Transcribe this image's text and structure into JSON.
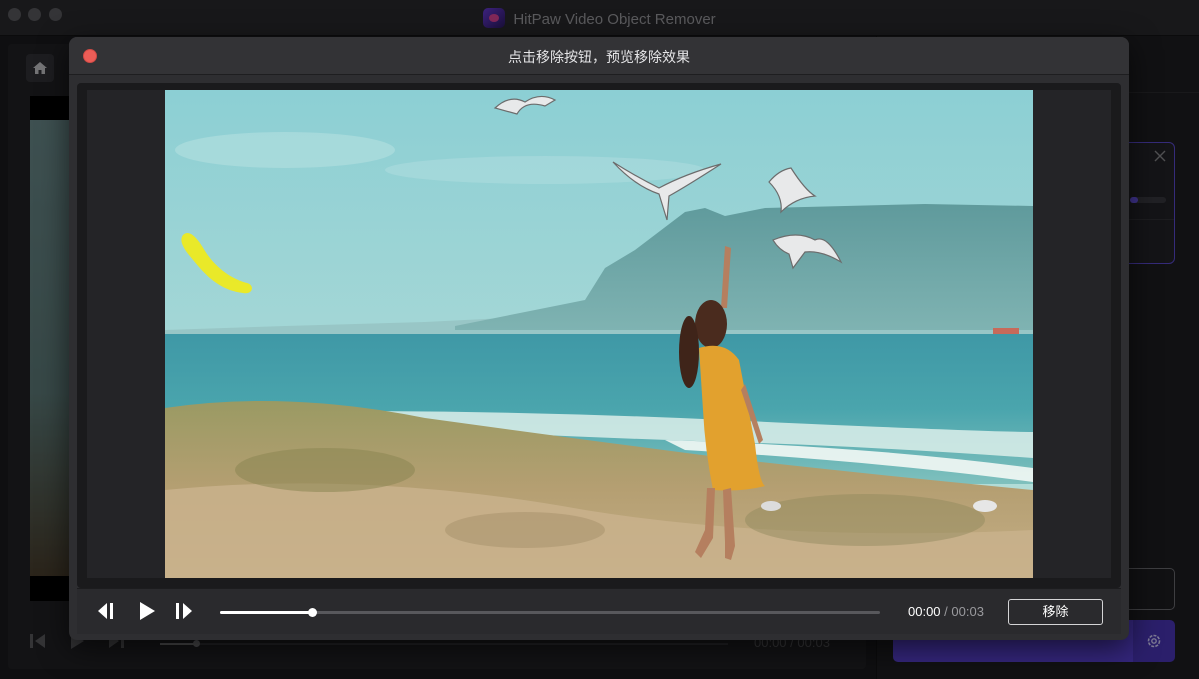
{
  "app": {
    "title": "HitPaw Video Object Remover"
  },
  "background": {
    "time_current": "00:00",
    "time_separator": "/",
    "time_total": "00:03"
  },
  "modal": {
    "title": "点击移除按钮，预览移除效果",
    "playback": {
      "current_time": "00:00",
      "separator": "/",
      "total_time": "00:03",
      "progress": 0.14
    },
    "remove_label": "移除"
  },
  "icons": {
    "home": "home-icon",
    "prev_frame": "step-backward-icon",
    "play": "play-icon",
    "next_frame": "step-forward-icon",
    "close": "close-icon",
    "settings": "gear-icon"
  },
  "colors": {
    "accent": "#5a43d6",
    "mask_highlight": "#f0ea1a",
    "close_dot": "#ec5d57"
  }
}
